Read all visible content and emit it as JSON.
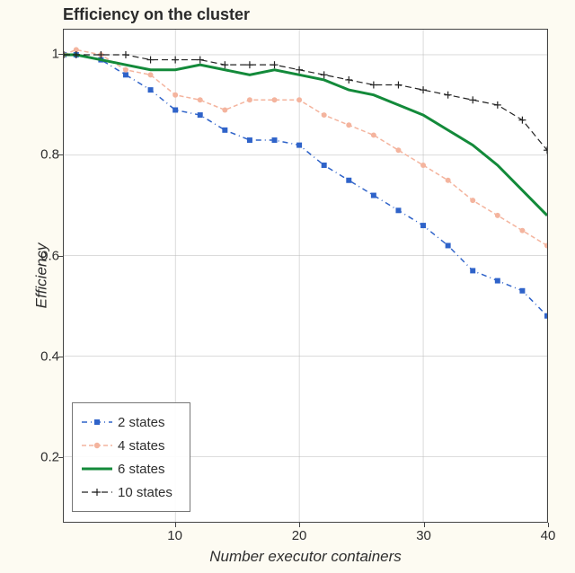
{
  "chart_data": {
    "type": "line",
    "title": "Efficiency on the cluster",
    "xlabel": "Number executor containers",
    "ylabel": "Efficiency",
    "xlim": [
      1,
      40
    ],
    "ylim": [
      0.07,
      1.05
    ],
    "xticks": [
      10,
      20,
      30,
      40
    ],
    "yticks": [
      0.2,
      0.4,
      0.6,
      0.8,
      1.0
    ],
    "x": [
      1,
      2,
      4,
      6,
      8,
      10,
      12,
      14,
      16,
      18,
      20,
      22,
      24,
      26,
      28,
      30,
      32,
      34,
      36,
      38,
      40
    ],
    "series": [
      {
        "name": "2 states",
        "style": "blue-dashdot-square",
        "values": [
          1.0,
          1.0,
          0.99,
          0.96,
          0.93,
          0.89,
          0.88,
          0.85,
          0.83,
          0.83,
          0.82,
          0.78,
          0.75,
          0.72,
          0.69,
          0.66,
          0.62,
          0.57,
          0.55,
          0.53,
          0.48
        ]
      },
      {
        "name": "4 states",
        "style": "salmon-dash-dot",
        "values": [
          1.0,
          1.01,
          1.0,
          0.97,
          0.96,
          0.92,
          0.91,
          0.89,
          0.91,
          0.91,
          0.91,
          0.88,
          0.86,
          0.84,
          0.81,
          0.78,
          0.75,
          0.71,
          0.68,
          0.65,
          0.62
        ]
      },
      {
        "name": "6 states",
        "style": "green-solid",
        "values": [
          1.0,
          1.0,
          0.99,
          0.98,
          0.97,
          0.97,
          0.98,
          0.97,
          0.96,
          0.97,
          0.96,
          0.95,
          0.93,
          0.92,
          0.9,
          0.88,
          0.85,
          0.82,
          0.78,
          0.73,
          0.68
        ]
      },
      {
        "name": "10 states",
        "style": "black-dash-plus",
        "values": [
          1.0,
          1.0,
          1.0,
          1.0,
          0.99,
          0.99,
          0.99,
          0.98,
          0.98,
          0.98,
          0.97,
          0.96,
          0.95,
          0.94,
          0.94,
          0.93,
          0.92,
          0.91,
          0.9,
          0.87,
          0.81
        ]
      }
    ],
    "legend_position": "lower-left",
    "grid": true
  },
  "colors": {
    "s0": "#2f63c9",
    "s1": "#f4b49e",
    "s2": "#138a3a",
    "s3": "#222222",
    "bg": "#fdfbf2"
  }
}
